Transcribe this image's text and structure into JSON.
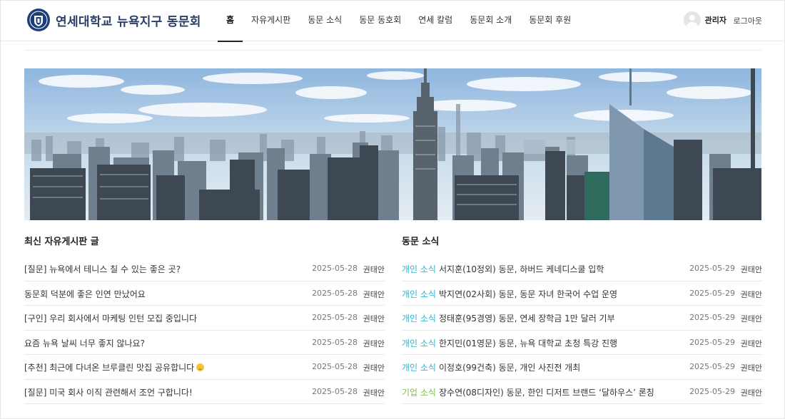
{
  "header": {
    "site_title": "연세대학교 뉴욕지구 동문회",
    "logo_icon": "yonsei-shield-icon",
    "nav": [
      {
        "label": "홈",
        "active": true
      },
      {
        "label": "자유게시판"
      },
      {
        "label": "동문 소식"
      },
      {
        "label": "동문 동호회"
      },
      {
        "label": "연세 칼럼"
      },
      {
        "label": "동문회 소개"
      },
      {
        "label": "동문회 후원"
      }
    ],
    "user_name": "관리자",
    "logout_label": "로그아웃"
  },
  "banner": {
    "icon": "new-york-skyline-photo"
  },
  "free_board": {
    "title": "최신 자유게시판 글",
    "posts": [
      {
        "title": "[질문] 뉴욕에서 테니스 칠 수 있는 좋은 곳?",
        "date": "2025-05-28",
        "author": "권태안"
      },
      {
        "title": "동문회 덕분에 좋은 인연 만났어요",
        "date": "2025-05-28",
        "author": "권태안"
      },
      {
        "title": "[구인] 우리 회사에서 마케팅 인턴 모집 중입니다",
        "date": "2025-05-28",
        "author": "권태안"
      },
      {
        "title": "요즘 뉴욕 날씨 너무 좋지 않나요?",
        "date": "2025-05-28",
        "author": "권태안"
      },
      {
        "title": "[추천] 최근에 다녀온 브루클린 맛집 공유합니다",
        "date": "2025-05-28",
        "author": "권태안",
        "emoji": "smiling-face-icon"
      },
      {
        "title": "[질문] 미국 회사 이직 관련해서 조언 구합니다!",
        "date": "2025-05-28",
        "author": "권태안"
      }
    ]
  },
  "alumni_news": {
    "title": "동문 소식",
    "colors": {
      "personal": "#2bb4cf",
      "business": "#7cc04b"
    },
    "posts": [
      {
        "category": "개인 소식",
        "type": "personal",
        "title": "서지훈(10정외) 동문, 하버드 케네디스쿨 입학",
        "date": "2025-05-29",
        "author": "권태안"
      },
      {
        "category": "개인 소식",
        "type": "personal",
        "title": "박지연(02사회) 동문, 동문 자녀 한국어 수업 운영",
        "date": "2025-05-29",
        "author": "권태안"
      },
      {
        "category": "개인 소식",
        "type": "personal",
        "title": "정태훈(95경영) 동문, 연세 장학금 1만 달러 기부",
        "date": "2025-05-29",
        "author": "권태안"
      },
      {
        "category": "개인 소식",
        "type": "personal",
        "title": "한지민(01영문) 동문, 뉴욕 대학교 초청 특강 진행",
        "date": "2025-05-29",
        "author": "권태안"
      },
      {
        "category": "개인 소식",
        "type": "personal",
        "title": "이정호(99건축) 동문, 개인 사진전 개최",
        "date": "2025-05-29",
        "author": "권태안"
      },
      {
        "category": "기업 소식",
        "type": "business",
        "title": "장수연(08디자인) 동문, 한인 디저트 브랜드 ‘달하우스’ 론칭",
        "date": "2025-05-29",
        "author": "권태안"
      }
    ]
  }
}
